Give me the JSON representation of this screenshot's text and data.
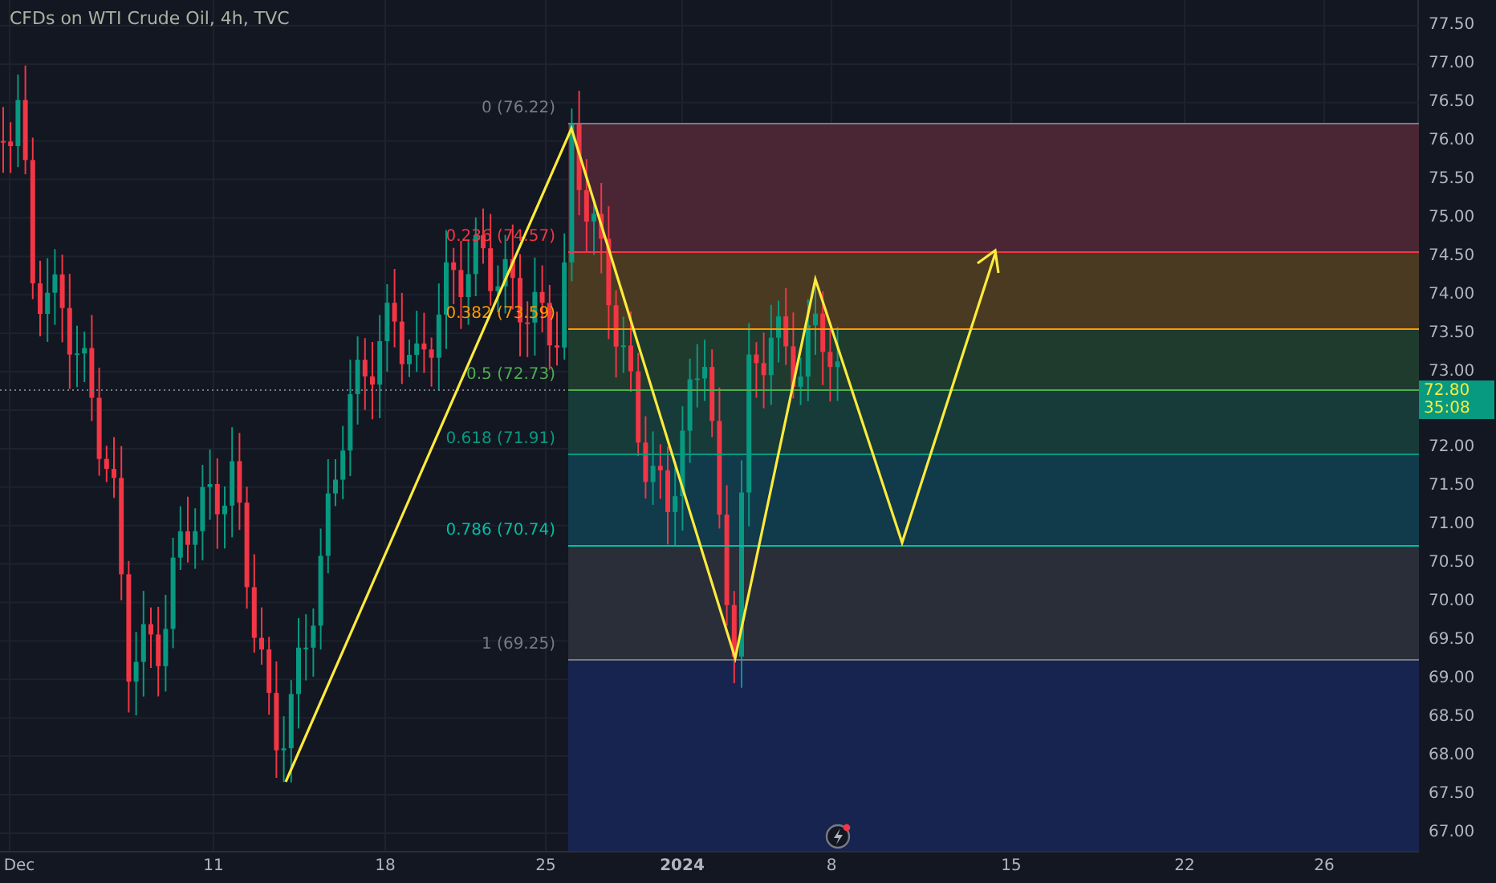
{
  "chart": {
    "title": "CFDs on WTI Crude Oil, 4h, TVC",
    "fib_levels": [
      {
        "label": "0 (76.22)",
        "color": "#787b86"
      },
      {
        "label": "0.236 (74.57)",
        "color": "#f23645"
      },
      {
        "label": "0.382 (73.59)",
        "color": "#ff9800"
      },
      {
        "label": "0.5 (72.73)",
        "color": "#4caf50"
      },
      {
        "label": "0.618 (71.91)",
        "color": "#089981"
      },
      {
        "label": "0.786 (70.74)",
        "color": "#00bfa5"
      },
      {
        "label": "1 (69.25)",
        "color": "#787b86"
      }
    ],
    "price_axis": [
      "77.50",
      "77.00",
      "76.50",
      "76.00",
      "75.50",
      "75.00",
      "74.50",
      "74.00",
      "73.50",
      "73.00",
      "72.00",
      "71.50",
      "71.00",
      "70.50",
      "70.00",
      "69.50",
      "69.00",
      "68.50",
      "68.00",
      "67.50",
      "67.00"
    ],
    "last_price": {
      "price": "72.80",
      "countdown": "35:08"
    },
    "time_axis": [
      {
        "label": "Dec",
        "major": false
      },
      {
        "label": "11",
        "major": false
      },
      {
        "label": "18",
        "major": false
      },
      {
        "label": "25",
        "major": false
      },
      {
        "label": "2024",
        "major": true
      },
      {
        "label": "8",
        "major": false
      },
      {
        "label": "15",
        "major": false
      },
      {
        "label": "22",
        "major": false
      },
      {
        "label": "26",
        "major": false
      }
    ]
  }
}
